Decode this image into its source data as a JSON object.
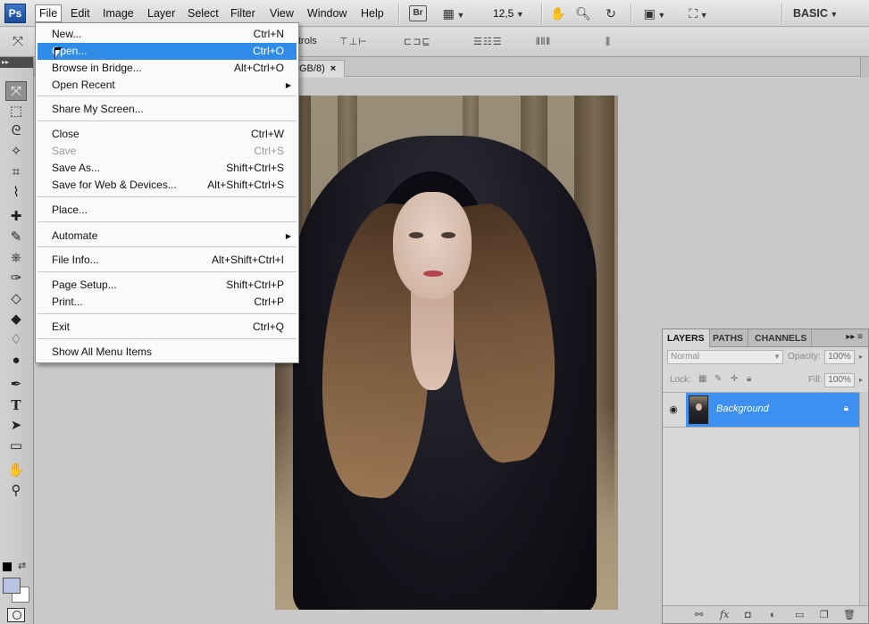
{
  "app": {
    "logo": "Ps",
    "workspace": "BASIC",
    "zoom": "12,5"
  },
  "menubar": [
    "File",
    "Edit",
    "Image",
    "Layer",
    "Select",
    "Filter",
    "View",
    "Window",
    "Help"
  ],
  "bridge_label": "Br",
  "options_bar": {
    "partial_label": "trols"
  },
  "document_tab": {
    "title": "GB/8)",
    "close": "×"
  },
  "file_menu": {
    "items": [
      {
        "label": "New...",
        "shortcut": "Ctrl+N"
      },
      {
        "label": "Open...",
        "shortcut": "Ctrl+O"
      },
      {
        "label": "Browse in Bridge...",
        "shortcut": "Alt+Ctrl+O"
      },
      {
        "label": "Open Recent",
        "shortcut": ""
      },
      {
        "label": "Share My Screen...",
        "shortcut": ""
      },
      {
        "label": "Close",
        "shortcut": "Ctrl+W"
      },
      {
        "label": "Save",
        "shortcut": "Ctrl+S"
      },
      {
        "label": "Save As...",
        "shortcut": "Shift+Ctrl+S"
      },
      {
        "label": "Save for Web & Devices...",
        "shortcut": "Alt+Shift+Ctrl+S"
      },
      {
        "label": "Place...",
        "shortcut": ""
      },
      {
        "label": "Automate",
        "shortcut": ""
      },
      {
        "label": "File Info...",
        "shortcut": "Alt+Shift+Ctrl+I"
      },
      {
        "label": "Page Setup...",
        "shortcut": "Shift+Ctrl+P"
      },
      {
        "label": "Print...",
        "shortcut": "Ctrl+P"
      },
      {
        "label": "Exit",
        "shortcut": "Ctrl+Q"
      },
      {
        "label": "Show All Menu Items",
        "shortcut": ""
      }
    ]
  },
  "layers_panel": {
    "tabs": [
      "LAYERS",
      "PATHS",
      "CHANNELS"
    ],
    "blend_mode": "Normal",
    "opacity_label": "Opacity:",
    "opacity": "100%",
    "lock_label": "Lock:",
    "fill_label": "Fill:",
    "fill": "100%",
    "layer_name": "Background"
  },
  "colors": {
    "accent": "#3d8ff0",
    "menu_highlight": "#2f8ce9",
    "foreground": "#b9c2e0",
    "background": "#ffffff"
  }
}
